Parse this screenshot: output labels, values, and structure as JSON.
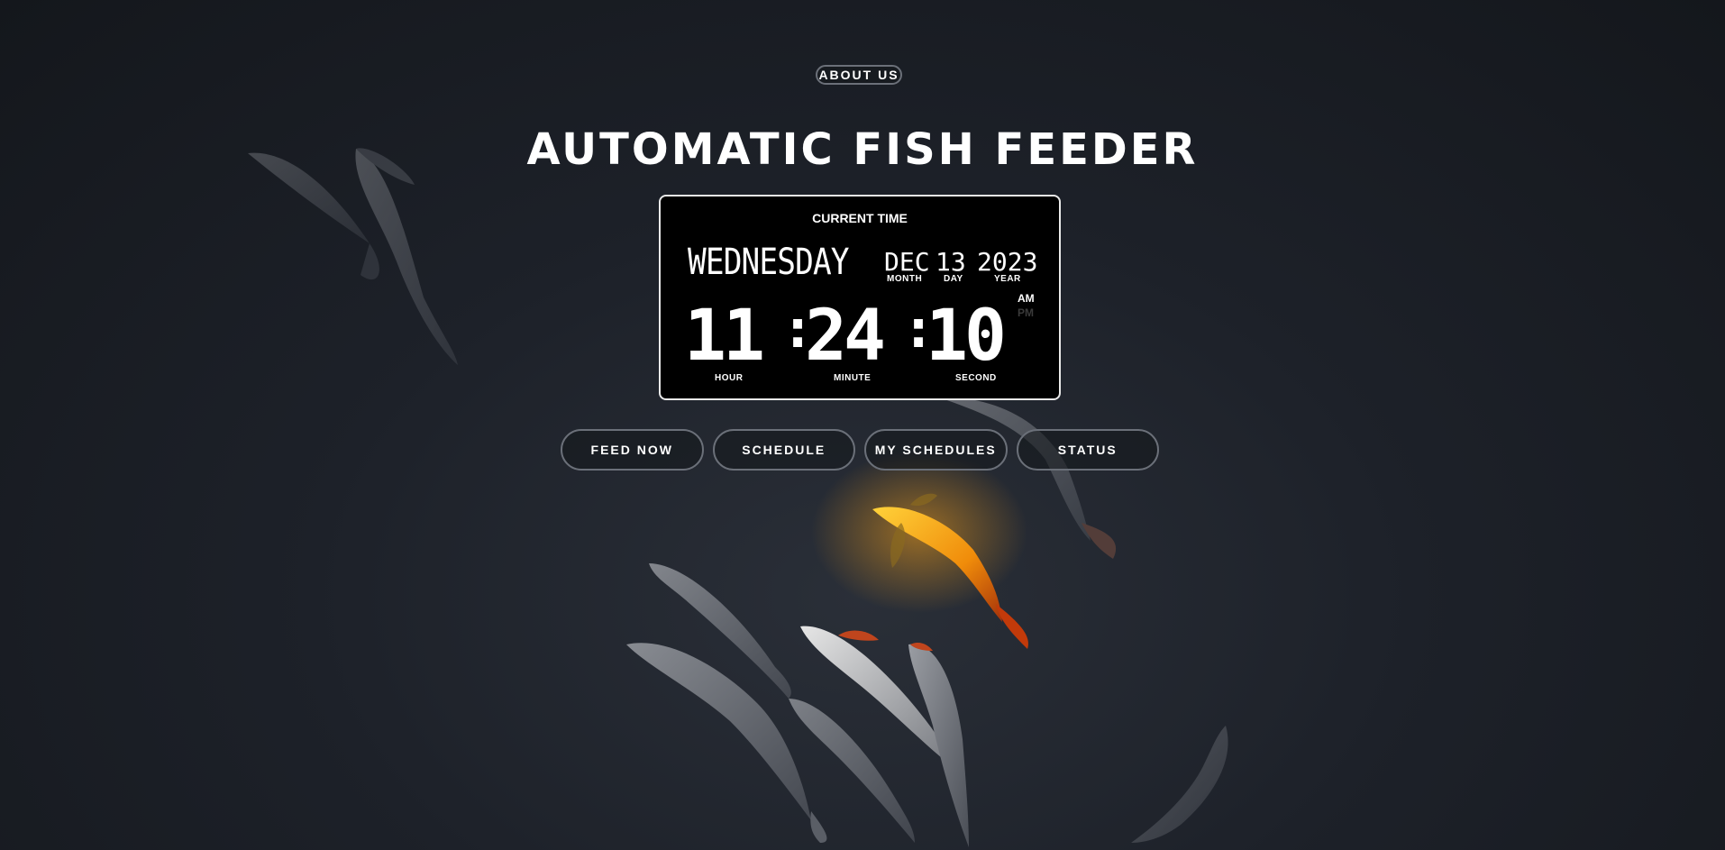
{
  "nav": {
    "about_label": "ABOUT US"
  },
  "header": {
    "title": "AUTOMATIC FISH FEEDER"
  },
  "clock": {
    "caption": "CURRENT TIME",
    "day_name": "WEDNESDAY",
    "month": "DEC",
    "day": "13",
    "year": "2023",
    "month_label": "MONTH",
    "day_label": "DAY",
    "year_label": "YEAR",
    "hour": "11",
    "minute": "24",
    "second": "10",
    "hour_label": "HOUR",
    "minute_label": "MINUTE",
    "second_label": "SECOND",
    "am_label": "AM",
    "pm_label": "PM"
  },
  "actions": {
    "feed_now": "FEED NOW",
    "schedule": "SCHEDULE",
    "my_schedules": "MY SCHEDULES",
    "status": "STATUS"
  },
  "colors": {
    "background": "#1d2129",
    "koi_gold": "#f2a40f",
    "button_border": "#6b7079"
  },
  "decor": {
    "background_art": "koi-fish-illustration"
  }
}
